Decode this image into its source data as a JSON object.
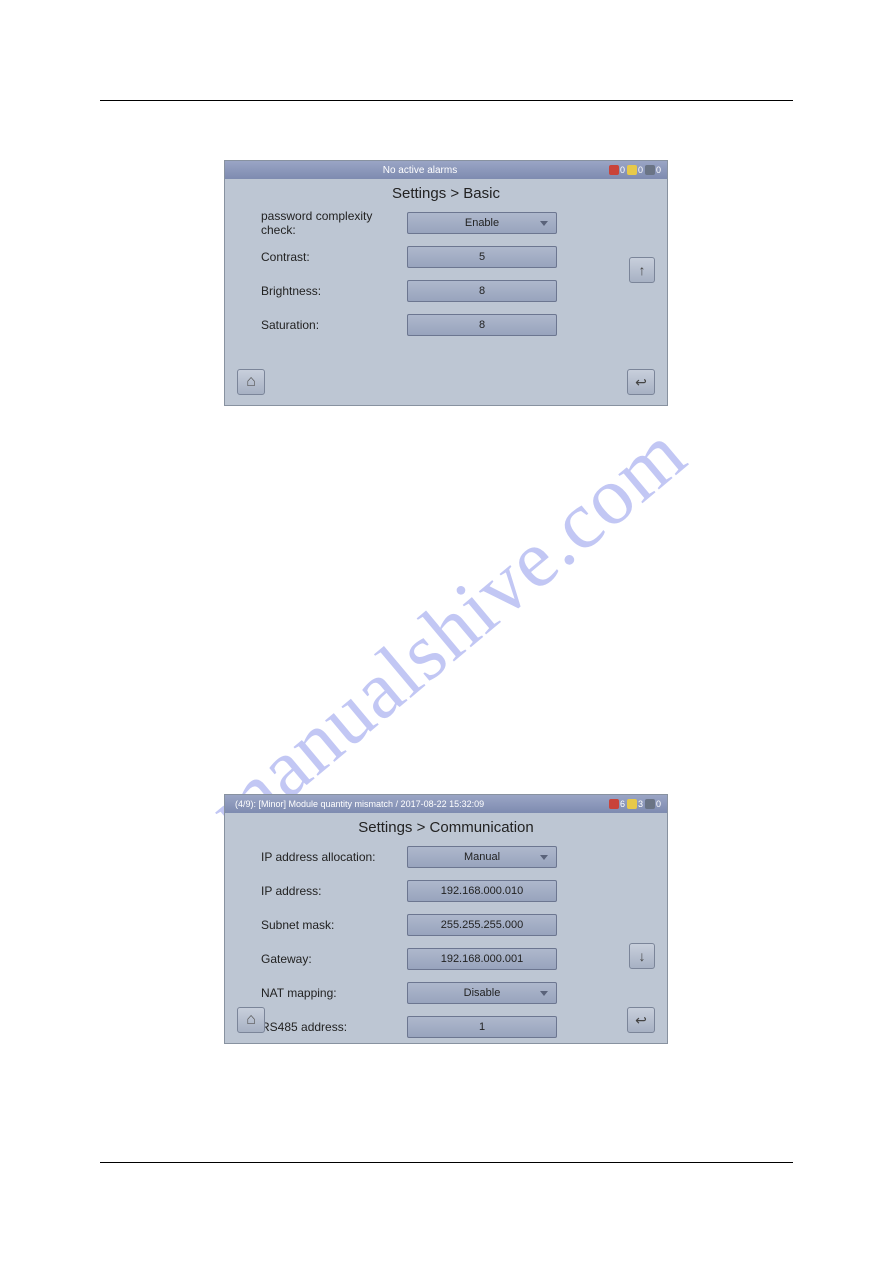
{
  "watermark": "manualshive.com",
  "screenshot1": {
    "status_text": "No active alarms",
    "badges": {
      "red": "0",
      "yellow": "0",
      "gray": "0"
    },
    "title": "Settings > Basic",
    "rows": [
      {
        "label": "password complexity check:",
        "value": "Enable",
        "type": "dropdown"
      },
      {
        "label": "Contrast:",
        "value": "5",
        "type": "value"
      },
      {
        "label": "Brightness:",
        "value": "8",
        "type": "value"
      },
      {
        "label": "Saturation:",
        "value": "8",
        "type": "value"
      }
    ]
  },
  "screenshot2": {
    "status_text": "(4/9): [Minor] Module quantity mismatch / 2017-08-22 15:32:09",
    "badges": {
      "red": "6",
      "yellow": "3",
      "gray": "0"
    },
    "title": "Settings > Communication",
    "rows": [
      {
        "label": "IP address allocation:",
        "value": "Manual",
        "type": "dropdown"
      },
      {
        "label": "IP address:",
        "value": "192.168.000.010",
        "type": "value"
      },
      {
        "label": "Subnet mask:",
        "value": "255.255.255.000",
        "type": "value"
      },
      {
        "label": "Gateway:",
        "value": "192.168.000.001",
        "type": "value"
      },
      {
        "label": "NAT mapping:",
        "value": "Disable",
        "type": "dropdown"
      },
      {
        "label": "RS485 address:",
        "value": "1",
        "type": "value"
      }
    ]
  }
}
